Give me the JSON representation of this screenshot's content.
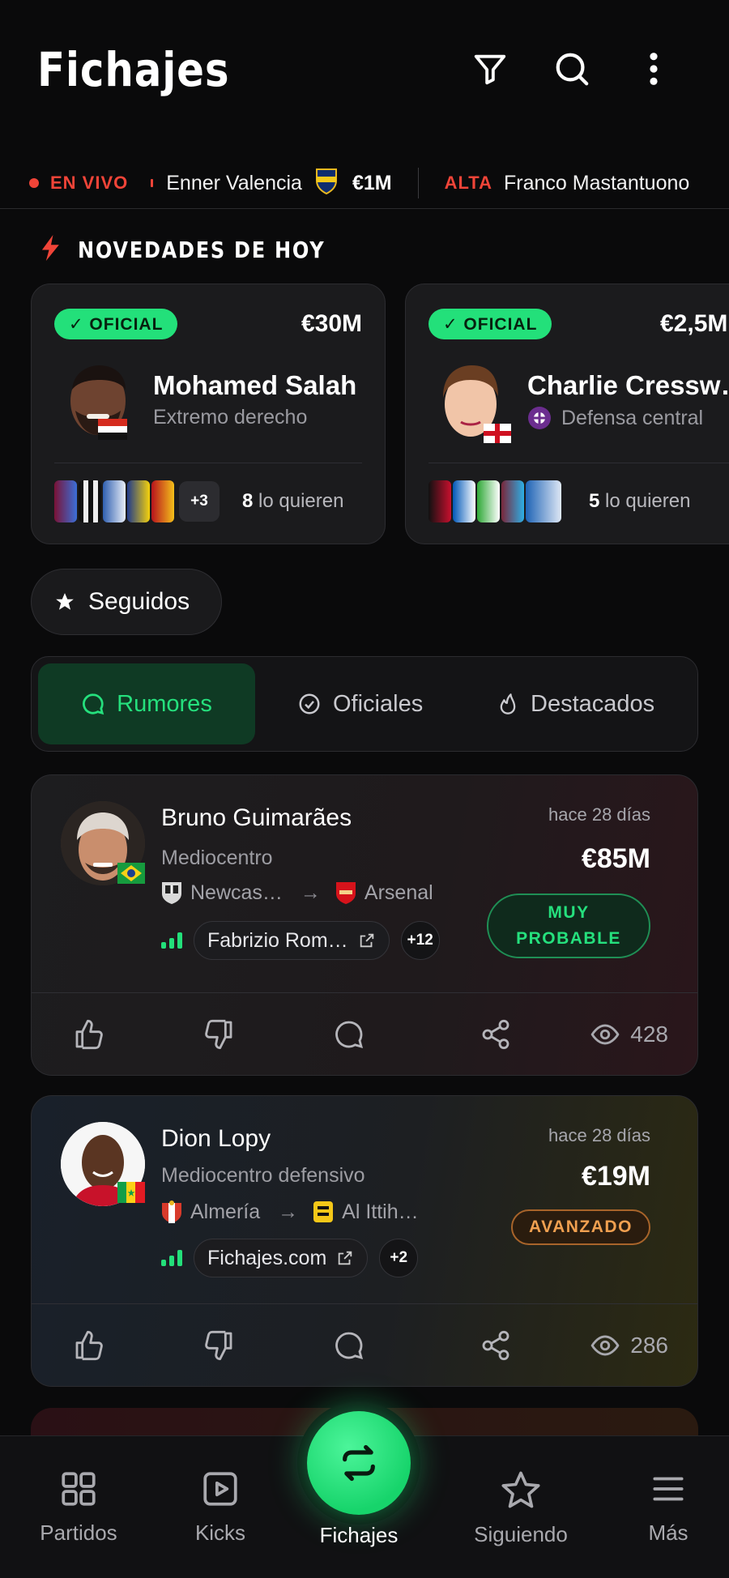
{
  "header": {
    "title": "Fichajes",
    "icons": [
      "filter-icon",
      "search-icon",
      "more-vert-icon"
    ]
  },
  "ticker": {
    "live_label": "EN VIVO",
    "item1": {
      "name": "Enner Valencia",
      "value": "€1M"
    },
    "item2": {
      "tag": "ALTA",
      "name": "Franco Mastantuono"
    }
  },
  "section": {
    "title": "NOVEDADES DE HOY"
  },
  "news_cards": [
    {
      "badge": "✓ OFICIAL",
      "price": "€30M",
      "name": "Mohamed Salah",
      "position": "Extremo derecho",
      "more": "+3",
      "want_count": "8",
      "want_label": "lo quieren"
    },
    {
      "badge": "✓ OFICIAL",
      "price": "€2,5M",
      "name": "Charlie Cressw…",
      "position": "Defensa central",
      "want_count": "5",
      "want_label": "lo quieren"
    }
  ],
  "seguidos": {
    "label": "Seguidos"
  },
  "tabs": [
    {
      "label": "Rumores",
      "active": true
    },
    {
      "label": "Oficiales",
      "active": false
    },
    {
      "label": "Destacados",
      "active": false
    }
  ],
  "rumors": [
    {
      "name": "Bruno Guimarães",
      "position": "Mediocentro",
      "from": "Newcas…",
      "to": "Arsenal",
      "source": "Fabrizio Rom…",
      "source_more": "+12",
      "time": "hace 28 días",
      "price": "€85M",
      "status_line1": "MUY",
      "status_line2": "PROBABLE",
      "views": "428"
    },
    {
      "name": "Dion Lopy",
      "position": "Mediocentro defensivo",
      "from": "Almería",
      "to": "Al Ittih…",
      "source": "Fichajes.com",
      "source_more": "+2",
      "time": "hace 28 días",
      "price": "€19M",
      "status": "AVANZADO",
      "views": "286"
    }
  ],
  "arrow": "→",
  "bottom_nav": [
    {
      "label": "Partidos"
    },
    {
      "label": "Kicks"
    },
    {
      "label": "Fichajes",
      "active": true
    },
    {
      "label": "Siguiendo"
    },
    {
      "label": "Más"
    }
  ],
  "colors": {
    "accent": "#23e07a",
    "live": "#f04438",
    "status_probable": "#23e07a",
    "status_avanzado": "#f0a050"
  }
}
